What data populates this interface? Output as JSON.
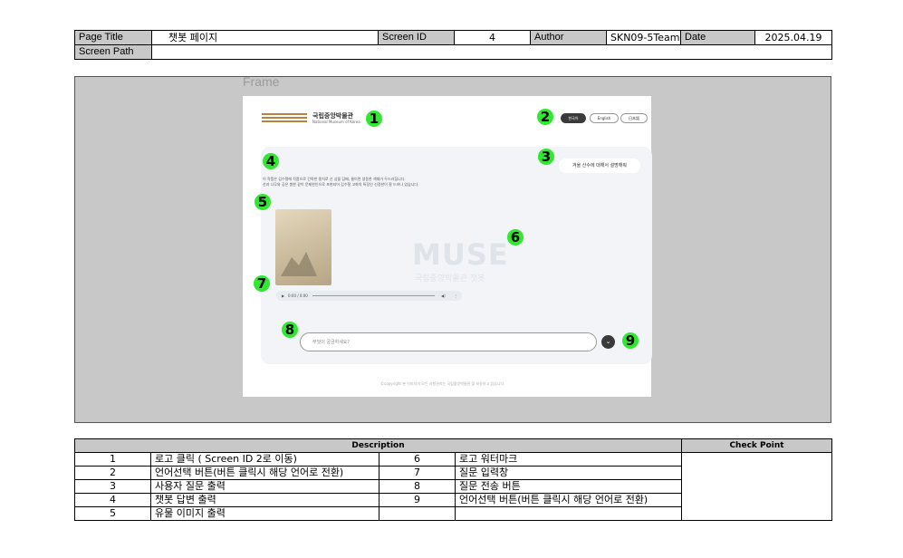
{
  "header": {
    "page_title_label": "Page Title",
    "page_title": "챗봇 페이지",
    "screen_id_label": "Screen ID",
    "screen_id": "4",
    "author_label": "Author",
    "author": "SKN09-5Team",
    "date_label": "Date",
    "date": "2025.04.19",
    "screen_path_label": "Screen Path",
    "screen_path": ""
  },
  "frame_label": "Frame",
  "screen": {
    "logo_text": "국립중앙박물관",
    "logo_sub": "National Museum of Korea",
    "languages": [
      "한국어",
      "English",
      "日本語"
    ],
    "user_message": "겨울 산수에 대해서 설명해줘",
    "bot_lines": [
      "이 작품은 김수철에 작품으로 간략한 필치로 산 삼을 담배, 물이면 생동한 색채가 두드러집니다.",
      "산과 나무와 공은 봄한 같이 문제한인으로 포현되어 김수철 고화의 특징인 신경한이 잘 드러나 있습니다."
    ],
    "watermark": "MUSE",
    "watermark_sub": "국립중앙박물관 챗봇",
    "audio_time": "0:00 / 0:00",
    "input_placeholder": "무엇이 궁금하세요?",
    "copyright": "©copyright 본 이미지의 모든 사항권리는 국립중앙박물관 및 보유하고 있습니다."
  },
  "badges": [
    "1",
    "2",
    "3",
    "4",
    "5",
    "6",
    "7",
    "8",
    "9"
  ],
  "description": {
    "header": "Description",
    "check_header": "Check Point",
    "rows": [
      {
        "n1": "1",
        "d1": "로고 클릭 ( Screen ID 2로 이동)",
        "n2": "6",
        "d2": "로고 워터마크"
      },
      {
        "n1": "2",
        "d1": "언어선택 버튼(버튼 클릭시 해당 언어로 전환)",
        "n2": "7",
        "d2": "질문 입력창"
      },
      {
        "n1": "3",
        "d1": "사용자 질문 출력",
        "n2": "8",
        "d2": "질문 전송 버튼"
      },
      {
        "n1": "4",
        "d1": "챗봇 답변 출력",
        "n2": "9",
        "d2": "언어선택 버튼(버튼 클릭시 해당 언어로 전환)"
      },
      {
        "n1": "5",
        "d1": "유물 이미지 출력",
        "n2": "",
        "d2": ""
      }
    ]
  },
  "colors": {
    "badge": "#2fe82f",
    "frame_bg": "#c8c8c8",
    "logo_gold": "#b5843f"
  }
}
